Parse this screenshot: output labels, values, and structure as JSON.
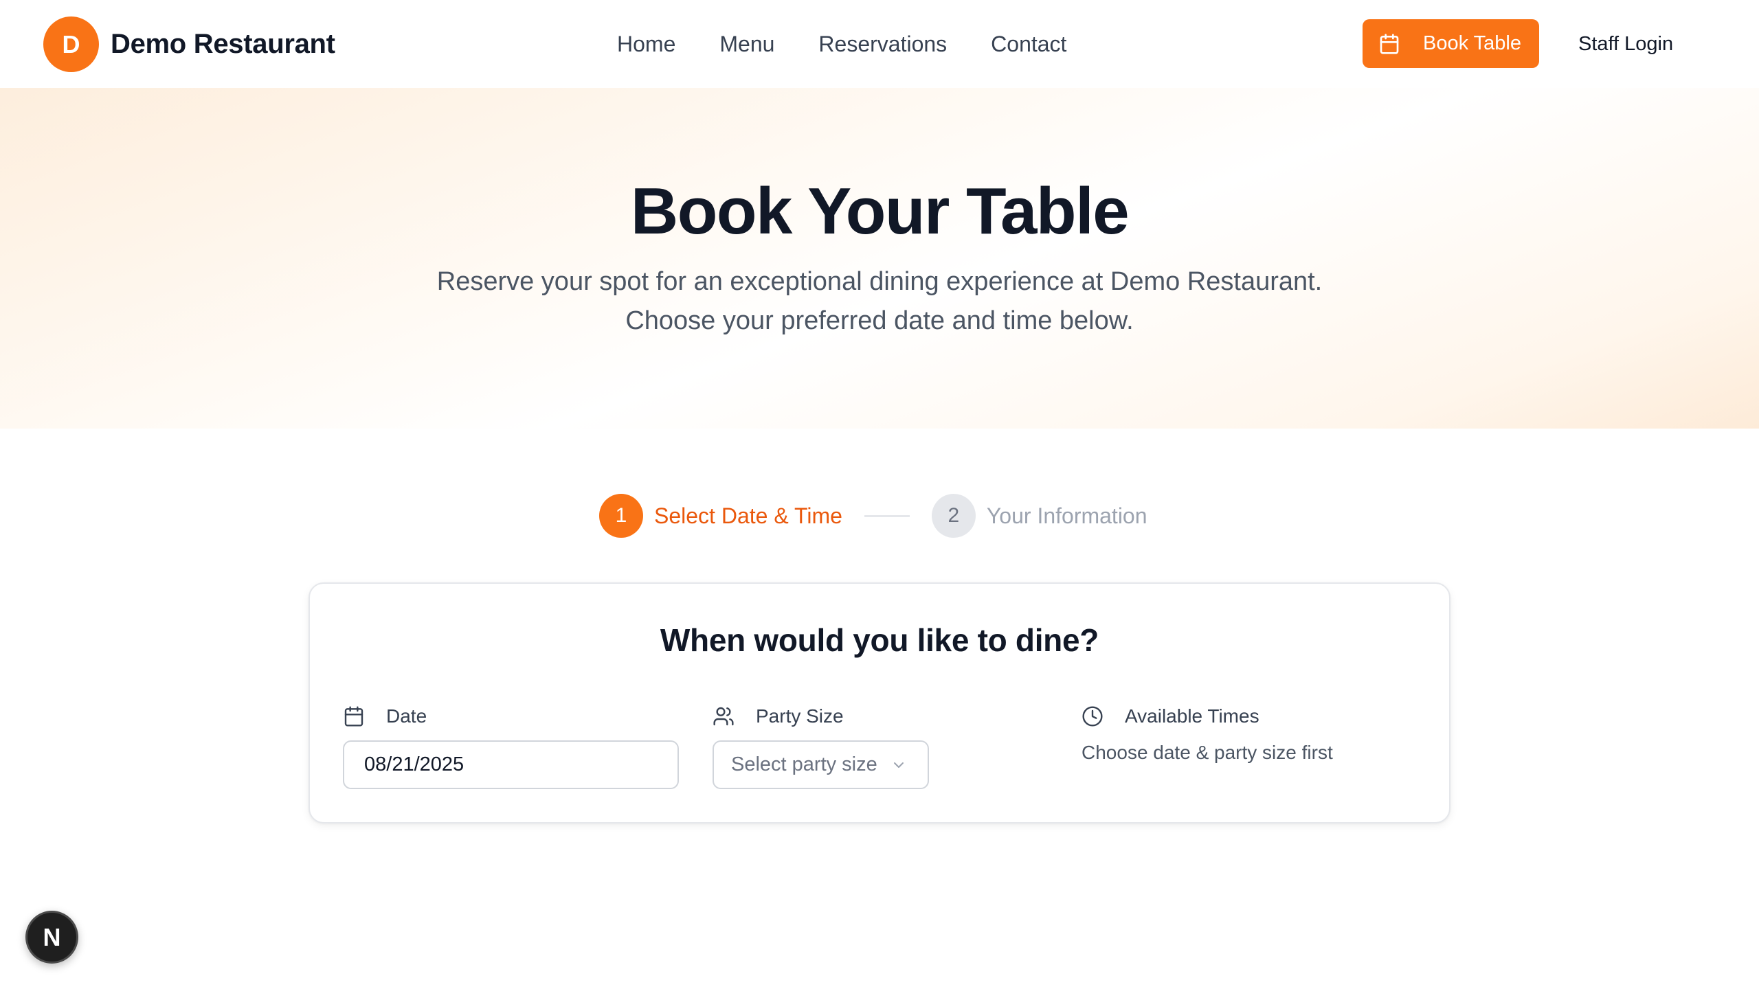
{
  "brand": {
    "logo_letter": "D",
    "name": "Demo Restaurant",
    "accent_color": "#f97316"
  },
  "nav": {
    "items": [
      {
        "label": "Home"
      },
      {
        "label": "Menu"
      },
      {
        "label": "Reservations"
      },
      {
        "label": "Contact"
      }
    ]
  },
  "header": {
    "book_button": {
      "label": "Book Table",
      "icon": "calendar-icon"
    },
    "staff_login": "Staff Login"
  },
  "hero": {
    "title": "Book Your Table",
    "subtitle_line1": "Reserve your spot for an exceptional dining experience at Demo Restaurant.",
    "subtitle_line2": "Choose your preferred date and time below."
  },
  "stepper": {
    "steps": [
      {
        "number": "1",
        "label": "Select Date & Time",
        "state": "active"
      },
      {
        "number": "2",
        "label": "Your Information",
        "state": "inactive"
      }
    ]
  },
  "form": {
    "title": "When would you like to dine?",
    "date": {
      "label": "Date",
      "icon": "calendar-icon",
      "value": "08/21/2025"
    },
    "party_size": {
      "label": "Party Size",
      "icon": "users-icon",
      "placeholder": "Select party size"
    },
    "available_times": {
      "label": "Available Times",
      "icon": "clock-icon",
      "hint": "Choose date & party size first"
    }
  },
  "dev_badge": {
    "letter": "N"
  }
}
